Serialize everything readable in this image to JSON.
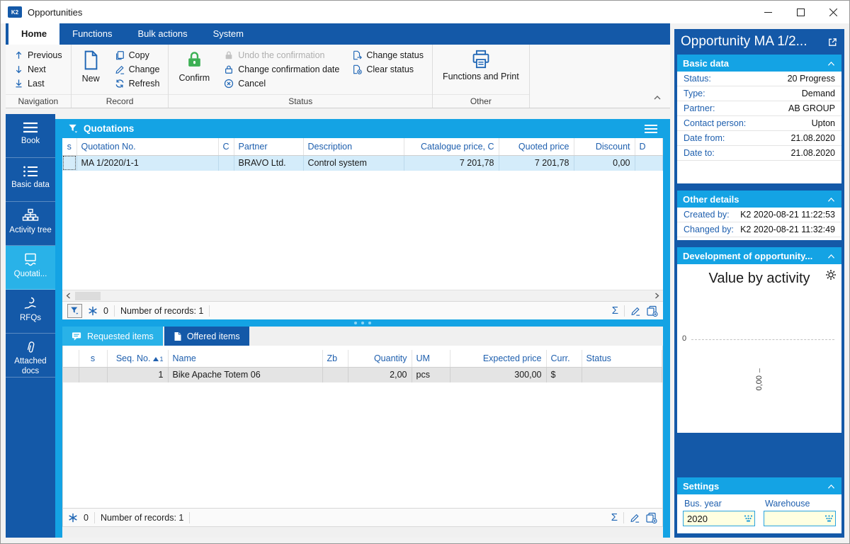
{
  "window": {
    "title": "Opportunities"
  },
  "colors": {
    "dark_blue": "#1459A8",
    "cyan_header": "#14A3E4",
    "active_sidebar": "#29B2E8",
    "selected_row": "#D4ECFA",
    "confirm_green": "#3CB054",
    "field_bg": "#FFFFE1"
  },
  "ribbon": {
    "tabs": [
      {
        "label": "Home",
        "active": true
      },
      {
        "label": "Functions"
      },
      {
        "label": "Bulk actions"
      },
      {
        "label": "System"
      }
    ],
    "navigation": {
      "label": "Navigation",
      "previous": "Previous",
      "next": "Next",
      "last": "Last"
    },
    "record": {
      "label": "Record",
      "new": "New",
      "copy": "Copy",
      "change": "Change",
      "refresh": "Refresh"
    },
    "status": {
      "label": "Status",
      "confirm": "Confirm",
      "undo": "Undo the confirmation",
      "change_date": "Change confirmation date",
      "cancel": "Cancel",
      "change_status": "Change status",
      "clear_status": "Clear status"
    },
    "other": {
      "label": "Other",
      "functions_print": "Functions and Print"
    }
  },
  "sidebar": {
    "items": [
      {
        "label": "Book"
      },
      {
        "label": "Basic data"
      },
      {
        "label": "Activity tree"
      },
      {
        "label": "Quotati..."
      },
      {
        "label": "RFQs"
      },
      {
        "label": "Attached docs"
      }
    ],
    "active_index": 3
  },
  "quotations": {
    "title": "Quotations",
    "columns": [
      "s",
      "Quotation No.",
      "C",
      "Partner",
      "Description",
      "Catalogue price, C",
      "Quoted price",
      "Discount",
      "D"
    ],
    "rows": [
      [
        "",
        "MA 1/2020/1-1",
        "",
        "BRAVO Ltd.",
        "Control system",
        "7 201,78",
        "7 201,78",
        "0,00",
        ""
      ]
    ],
    "status_bar": {
      "pinned_count": "0",
      "records": "Number of records: 1"
    }
  },
  "items": {
    "tabs": [
      {
        "label": "Requested items"
      },
      {
        "label": "Offered items",
        "active": true
      }
    ],
    "columns": [
      "",
      "s",
      "Seq. No.",
      "Name",
      "Zb",
      "Quantity",
      "UM",
      "Expected price",
      "Curr.",
      "Status"
    ],
    "sort": {
      "column": "Seq. No.",
      "order": "1"
    },
    "rows": [
      [
        "",
        "",
        "1",
        "Bike Apache Totem 06",
        "",
        "2,00",
        "pcs",
        "300,00",
        "$",
        ""
      ]
    ],
    "status_bar": {
      "pinned_count": "0",
      "records": "Number of records: 1"
    }
  },
  "detail": {
    "title": "Opportunity MA 1/2...",
    "basic": {
      "title": "Basic data",
      "fields": [
        {
          "label": "Status:",
          "value": "20 Progress"
        },
        {
          "label": "Type:",
          "value": "Demand"
        },
        {
          "label": "Partner:",
          "value": "AB GROUP"
        },
        {
          "label": "Contact person:",
          "value": "Upton"
        },
        {
          "label": "Date from:",
          "value": "21.08.2020"
        },
        {
          "label": "Date to:",
          "value": "21.08.2020"
        }
      ]
    },
    "other": {
      "title": "Other details",
      "fields": [
        {
          "label": "Created by:",
          "value": "K2 2020-08-21 11:22:53"
        },
        {
          "label": "Changed by:",
          "value": "K2 2020-08-21 11:32:49"
        }
      ]
    },
    "development": {
      "title": "Development of opportunity...",
      "chart": {
        "type": "line",
        "title": "Value by activity",
        "y_ticks": [
          "0"
        ],
        "x_ticks": [
          "0,00"
        ],
        "series": []
      }
    },
    "settings": {
      "title": "Settings",
      "fields": [
        {
          "label": "Bus. year",
          "value": "2020"
        },
        {
          "label": "Warehouse",
          "value": ""
        }
      ]
    }
  }
}
